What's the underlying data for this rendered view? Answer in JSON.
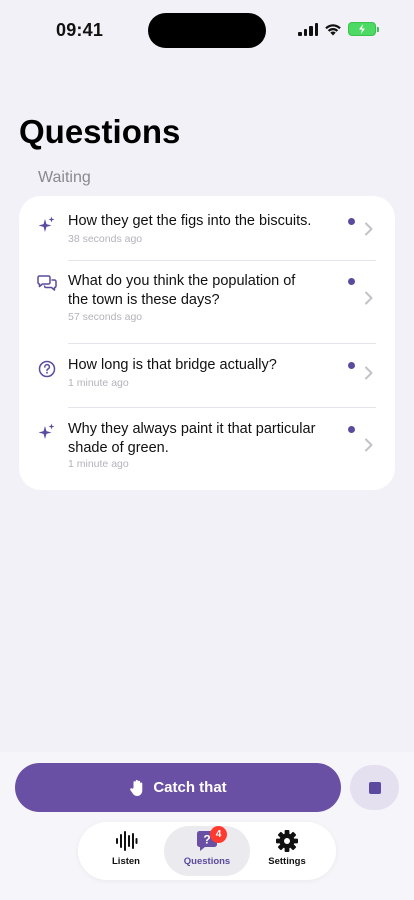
{
  "status_bar": {
    "time": "09:41"
  },
  "page": {
    "title": "Questions",
    "section_label": "Waiting"
  },
  "questions": [
    {
      "text": "How they get the figs into the biscuits.",
      "time": "38 seconds ago",
      "icon": "sparkles-icon"
    },
    {
      "text": "What do you think the population of the town is these days?",
      "time": "57 seconds ago",
      "icon": "chat-bubbles-icon"
    },
    {
      "text": "How long is that bridge actually?",
      "time": "1 minute ago",
      "icon": "question-circle-icon"
    },
    {
      "text": "Why they always paint it that particular shade of green.",
      "time": "1 minute ago",
      "icon": "sparkles-icon"
    }
  ],
  "actions": {
    "catch_label": "Catch that"
  },
  "tabs": [
    {
      "label": "Listen",
      "icon": "waveform-icon"
    },
    {
      "label": "Questions",
      "icon": "question-bubble-icon",
      "badge": "4"
    },
    {
      "label": "Settings",
      "icon": "gear-icon"
    }
  ],
  "colors": {
    "accent": "#6a50a5",
    "badge": "#ff3b30",
    "background": "#f2f1f7"
  }
}
